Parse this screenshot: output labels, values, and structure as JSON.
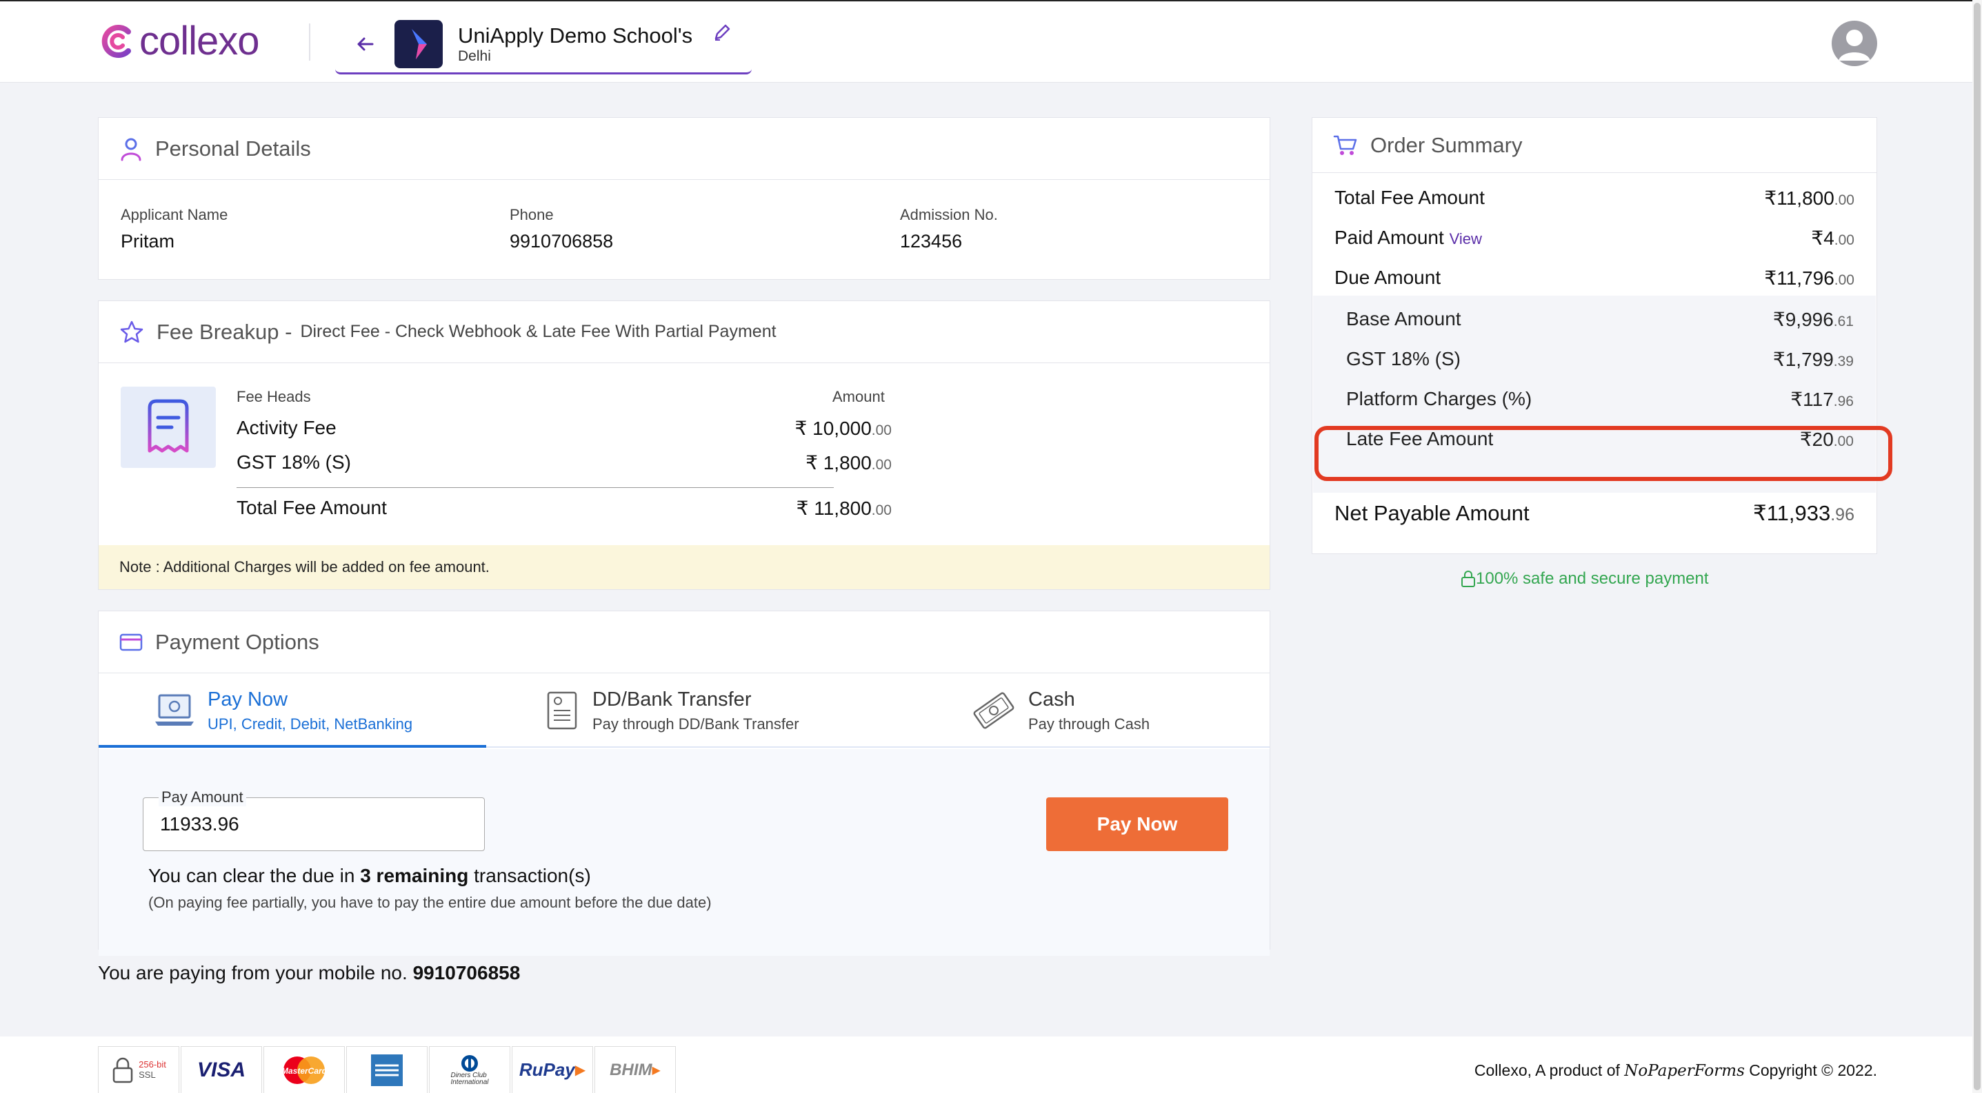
{
  "header": {
    "logo_text": "collexo",
    "school_name": "UniApply Demo School's",
    "school_city": "Delhi"
  },
  "personal_details": {
    "title": "Personal Details",
    "fields": [
      {
        "label": "Applicant Name",
        "value": "Pritam"
      },
      {
        "label": "Phone",
        "value": "9910706858"
      },
      {
        "label": "Admission No.",
        "value": "123456"
      }
    ]
  },
  "fee_breakup": {
    "title": "Fee Breakup -",
    "subtitle": "Direct Fee - Check Webhook & Late Fee With Partial Payment",
    "col_heads": "Fee Heads",
    "col_amount": "Amount",
    "rows": [
      {
        "name": "Activity Fee",
        "symbol": "₹",
        "int": "10,000",
        "dec": ".00"
      },
      {
        "name": "GST 18% (S)",
        "symbol": "₹",
        "int": "1,800",
        "dec": ".00"
      }
    ],
    "total": {
      "name": "Total Fee Amount",
      "symbol": "₹",
      "int": "11,800",
      "dec": ".00"
    },
    "note": "Note : Additional Charges will be added on fee amount."
  },
  "payment_options": {
    "title": "Payment Options",
    "tabs": [
      {
        "title": "Pay Now",
        "desc": "UPI, Credit, Debit, NetBanking"
      },
      {
        "title": "DD/Bank Transfer",
        "desc": "Pay through DD/Bank Transfer"
      },
      {
        "title": "Cash",
        "desc": "Pay through Cash"
      }
    ],
    "pay_amount_label": "Pay Amount",
    "pay_amount_value": "11933.96",
    "pay_button": "Pay Now",
    "clear_prefix": "You can clear the due in ",
    "clear_bold": "3 remaining",
    "clear_suffix": " transaction(s)",
    "clear_note": "(On paying fee partially, you have to pay the entire due amount before the due date)"
  },
  "mobile": {
    "prefix": "You are paying from your mobile no. ",
    "number": "9910706858"
  },
  "order_summary": {
    "title": "Order Summary",
    "total_fee": {
      "label": "Total Fee Amount",
      "symbol": "₹",
      "int": "11,800",
      "dec": ".00"
    },
    "paid": {
      "label": "Paid Amount",
      "link": "View",
      "symbol": "₹",
      "int": "4",
      "dec": ".00"
    },
    "due": {
      "label": "Due Amount",
      "symbol": "₹",
      "int": "11,796",
      "dec": ".00"
    },
    "breakdown": [
      {
        "label": "Base Amount",
        "symbol": "₹",
        "int": "9,996",
        "dec": ".61"
      },
      {
        "label": "GST 18% (S)",
        "symbol": "₹",
        "int": "1,799",
        "dec": ".39"
      },
      {
        "label": "Platform Charges (%)",
        "symbol": "₹",
        "int": "117",
        "dec": ".96"
      },
      {
        "label": "Late Fee Amount",
        "symbol": "₹",
        "int": "20",
        "dec": ".00"
      }
    ],
    "net": {
      "label": "Net Payable Amount",
      "symbol": "₹",
      "int": "11,933",
      "dec": ".96"
    },
    "secure": "100% safe and secure payment"
  },
  "footer": {
    "ssl_top": "256-bit",
    "ssl_bottom": "SSL",
    "visa": "VISA",
    "mastercard": "MasterCard",
    "diners_line1": "Diners Club",
    "diners_line2": "International",
    "rupay": "RuPay",
    "bhim": "BHIM",
    "copyright_prefix": "Collexo, A product of ",
    "copyright_brand": "NoPaperForms",
    "copyright_suffix": " Copyright © 2022."
  },
  "colors": {
    "brand": "#6e2f8f",
    "accent_blue": "#1a6fd6",
    "pay_button": "#ee6d37",
    "highlight": "#e23a22",
    "secure_green": "#33a650"
  }
}
